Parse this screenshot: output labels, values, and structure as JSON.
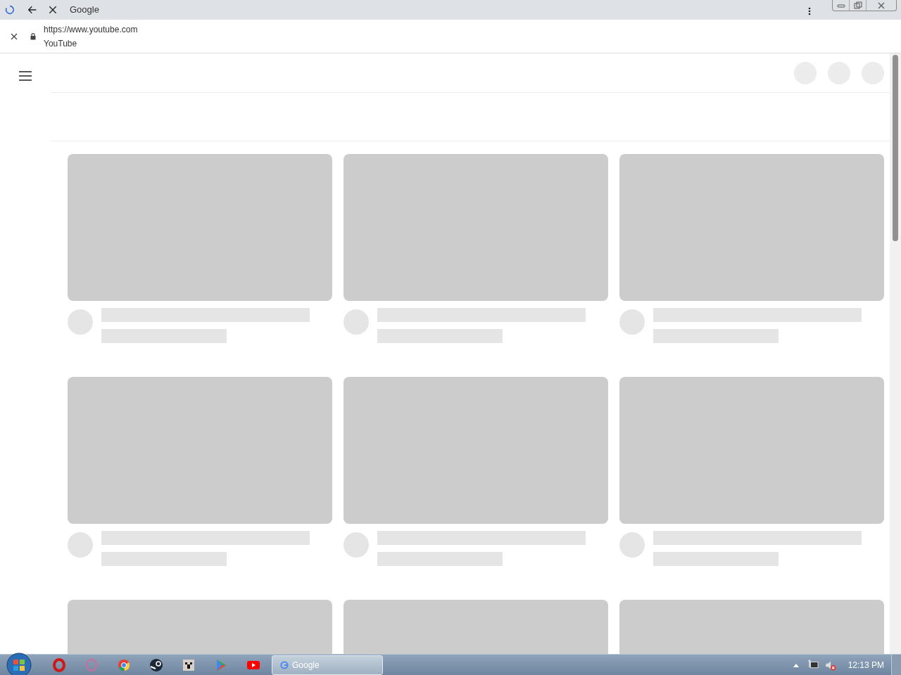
{
  "window": {
    "title": "Google"
  },
  "address_bar": {
    "url": "https://www.youtube.com",
    "page_title": "YouTube"
  },
  "video_grid": [
    {
      "kind": "skeleton"
    },
    {
      "kind": "skeleton"
    },
    {
      "kind": "skeleton"
    },
    {
      "kind": "skeleton"
    },
    {
      "kind": "skeleton"
    },
    {
      "kind": "skeleton"
    },
    {
      "kind": "thumbnail"
    },
    {
      "kind": "thumbnail"
    },
    {
      "kind": "thumbnail"
    }
  ],
  "taskbar": {
    "window_button": "Google",
    "clock": "12:13 PM"
  }
}
